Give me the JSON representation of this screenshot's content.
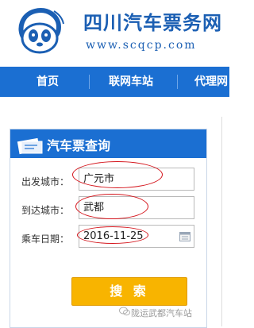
{
  "header": {
    "title": "四川汽车票务网",
    "url": "www.scqcp.com",
    "logo_icon": "panda-bus-logo-icon"
  },
  "nav": {
    "items": [
      {
        "label": "首页"
      },
      {
        "label": "联网车站"
      },
      {
        "label": "代理网"
      }
    ]
  },
  "search_panel": {
    "title": "汽车票查询",
    "icon": "ticket-icon",
    "fields": {
      "from": {
        "label": "出发城市：",
        "value": "广元市"
      },
      "to": {
        "label": "到达城市：",
        "value": "武都"
      },
      "date": {
        "label": "乘车日期：",
        "value": "2016-11-25",
        "icon": "calendar-icon"
      }
    },
    "search_label": "搜 索"
  },
  "watermark": {
    "text": "陇运武都汽车站",
    "icon": "wechat-icon"
  },
  "colors": {
    "brand_blue": "#1b6fd2",
    "accent_orange": "#f8b400",
    "annotation_red": "#d4141b"
  }
}
